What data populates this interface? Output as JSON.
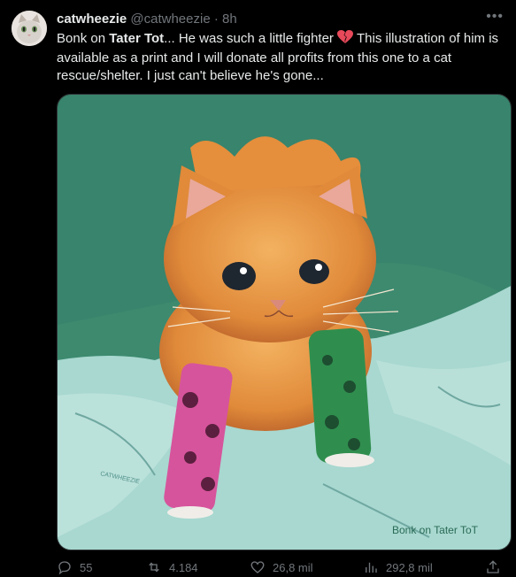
{
  "author": {
    "display_name": "catwheezie",
    "handle": "@catwheezie",
    "separator": "·",
    "time": "8h"
  },
  "more_icon": "more-horizontal-icon",
  "tweet": {
    "part1": "Bonk on ",
    "bold": "Tater Tot",
    "part2": "... He was such a little fighter ",
    "emoji": "broken-heart-icon",
    "part3": " This illustration of him is available as a print and I will donate all profits from this one to a cat rescue/shelter. I just can't believe he's gone..."
  },
  "media": {
    "signature": "Bonk on Tater ToT",
    "watermark": "CATWHEEZIE",
    "colors": {
      "background": "#3d8a6f",
      "blanket": "#a8d8d0",
      "fur": "#e08a3a",
      "pink_cast": "#d6549c",
      "green_cast": "#2f8e4e"
    }
  },
  "actions": {
    "replies": "55",
    "reposts": "4.184",
    "likes": "26,8 mil",
    "views": "292,8 mil"
  }
}
